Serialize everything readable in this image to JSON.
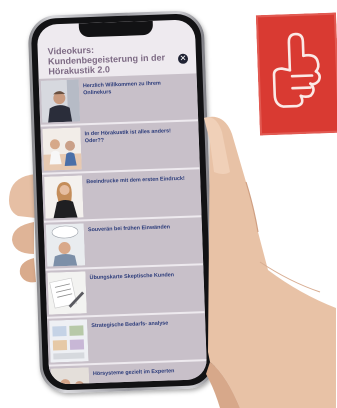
{
  "app": {
    "header_title": "Videokurs: Kundenbegeisterung in der Hörakustik 2.0",
    "close_icon": "close-icon"
  },
  "lessons": [
    {
      "label": "Herzlich Willkommen zu Ihrem Onlinekurs",
      "thumb": "presenter-photo"
    },
    {
      "label": "In der Hörakustik ist alles anders! Oder??",
      "thumb": "consultation-photo"
    },
    {
      "label": "Beeindrucke mit dem ersten Eindruck!",
      "thumb": "woman-photo"
    },
    {
      "label": "Souverän bei frühen Einwänden",
      "thumb": "thinking-man-photo"
    },
    {
      "label": "Übungskarte Skeptische Kunden",
      "thumb": "exercise-card-photo"
    },
    {
      "label": "Strategische Bedarfs- analyse",
      "thumb": "analysis-photo"
    },
    {
      "label": "Hörsysteme gezielt im Experten",
      "thumb": "expert-photo"
    }
  ],
  "stamp": {
    "icon": "thumbs-up-icon",
    "color": "#d93a32"
  }
}
